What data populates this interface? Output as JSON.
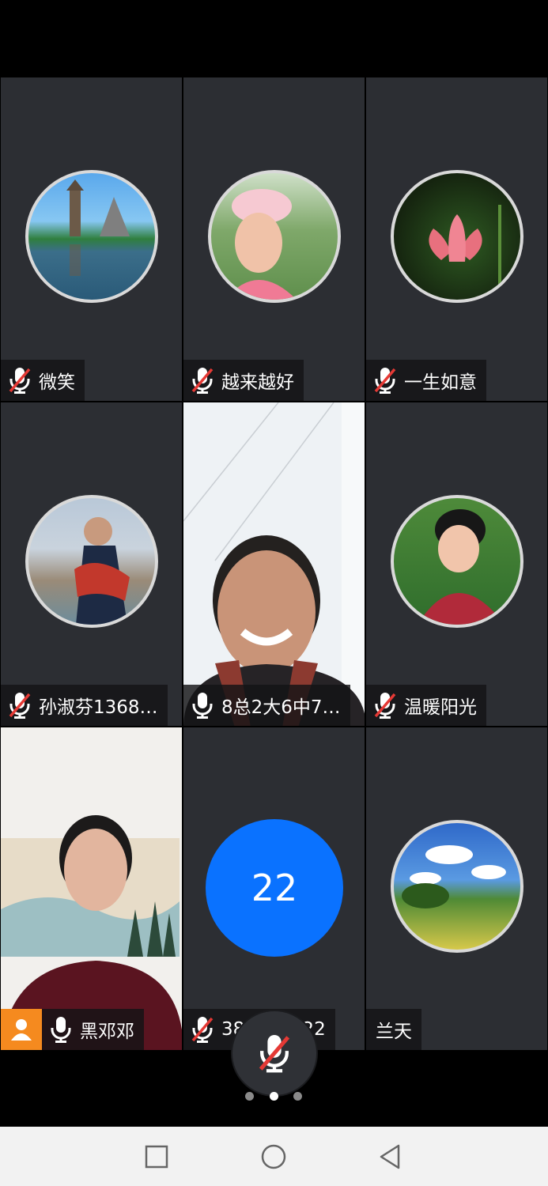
{
  "participants": [
    {
      "name": "微笑",
      "muted": true
    },
    {
      "name": "越来越好",
      "muted": true
    },
    {
      "name": "一生如意",
      "muted": true
    },
    {
      "name": "孙淑芬1368…",
      "muted": true
    },
    {
      "name": "8总2大6中7…",
      "muted": false
    },
    {
      "name": "温暖阳光",
      "muted": true
    },
    {
      "name": "黑邓邓",
      "muted": false
    },
    {
      "name": "388926222",
      "muted": true
    },
    {
      "name": "兰天",
      "muted": null
    }
  ],
  "count_badge": "22",
  "pager": {
    "pages": 3,
    "current": 2
  },
  "colors": {
    "tile_bg": "#2c2e33",
    "count_circle": "#0a72ff",
    "host_badge": "#f58a1f",
    "navbar_bg": "#f2f2f2"
  },
  "icons": {
    "mic": "mic-icon",
    "mic_muted": "mic-muted-icon",
    "host": "person-icon",
    "nav_recent": "square-icon",
    "nav_home": "circle-icon",
    "nav_back": "triangle-back-icon"
  }
}
